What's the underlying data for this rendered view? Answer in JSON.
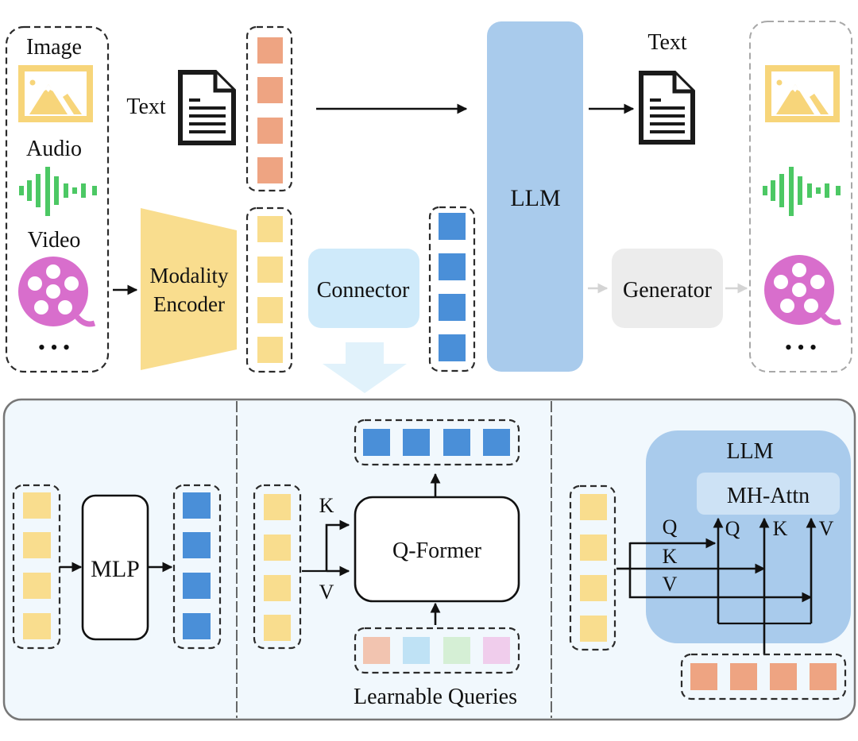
{
  "colors": {
    "image_yellow": "#f7d57a",
    "audio_green": "#4cc864",
    "video_magenta": "#d86ecc",
    "text_token_orange": "#eea482",
    "modality_token_yellow": "#f9dd8e",
    "llm_token_blue": "#4a8fd8",
    "llm_block_blue": "#a9cbec",
    "connector_blue": "#cfeafa",
    "generator_grey": "#ececec",
    "panel_bg": "#f1f8fd",
    "query_colors": [
      "#f2c4b0",
      "#bfe2f5",
      "#d5efd5",
      "#f0cdec"
    ]
  },
  "top": {
    "input_modalities": {
      "image_label": "Image",
      "audio_label": "Audio",
      "video_label": "Video",
      "more_label": "• • •"
    },
    "text_input_label": "Text",
    "modality_encoder_label": [
      "Modality",
      "Encoder"
    ],
    "connector_label": "Connector",
    "llm_label": "LLM",
    "text_output_label": "Text",
    "generator_label": "Generator",
    "output_modalities": {
      "more_label": "• • •"
    }
  },
  "bottom": {
    "mlp": {
      "label": "MLP"
    },
    "qformer": {
      "label": "Q-Former",
      "k_label": "K",
      "v_label": "V",
      "queries_label": "Learnable Queries"
    },
    "cross_attn": {
      "llm_label": "LLM",
      "attn_label": "MH-Attn",
      "in_labels": [
        "Q",
        "K",
        "V"
      ],
      "out_labels": [
        "Q",
        "K",
        "V"
      ]
    }
  }
}
